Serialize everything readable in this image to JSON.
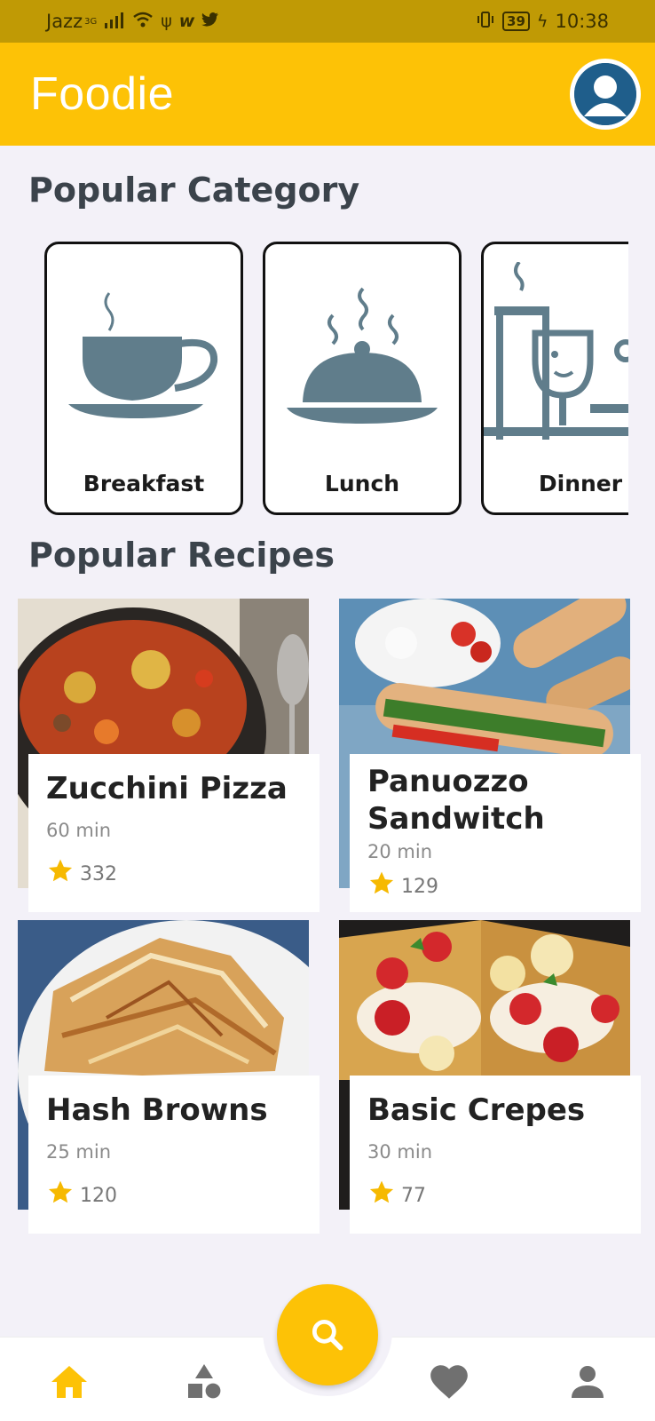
{
  "status_bar": {
    "carrier": "Jazz",
    "network": "3G",
    "battery": "39",
    "time": "10:38"
  },
  "app_bar": {
    "title": "Foodie"
  },
  "sections": {
    "categories_title": "Popular Category",
    "recipes_title": "Popular Recipes"
  },
  "categories": [
    {
      "label": "Breakfast",
      "icon": "coffee-cup-icon"
    },
    {
      "label": "Lunch",
      "icon": "serving-cloche-icon"
    },
    {
      "label": "Dinner",
      "icon": "candle-wine-icon"
    }
  ],
  "recipes": [
    {
      "name": "Zucchini Pizza",
      "time": "60 min",
      "rating": "332"
    },
    {
      "name": "Panuozzo Sandwitch",
      "time": "20 min",
      "rating": "129"
    },
    {
      "name": "Hash Browns",
      "time": "25 min",
      "rating": "120"
    },
    {
      "name": "Basic Crepes",
      "time": "30 min",
      "rating": "77"
    }
  ],
  "bottom_nav": [
    {
      "icon": "home-icon",
      "active": true
    },
    {
      "icon": "shapes-icon",
      "active": false
    },
    {
      "icon": "search-icon",
      "active": false
    },
    {
      "icon": "heart-icon",
      "active": false
    },
    {
      "icon": "person-icon",
      "active": false
    }
  ],
  "colors": {
    "accent": "#fdc206",
    "status_bar": "#c09a05",
    "background": "#f3f1f8",
    "icon_slate": "#607d8b",
    "star": "#f6b900"
  }
}
